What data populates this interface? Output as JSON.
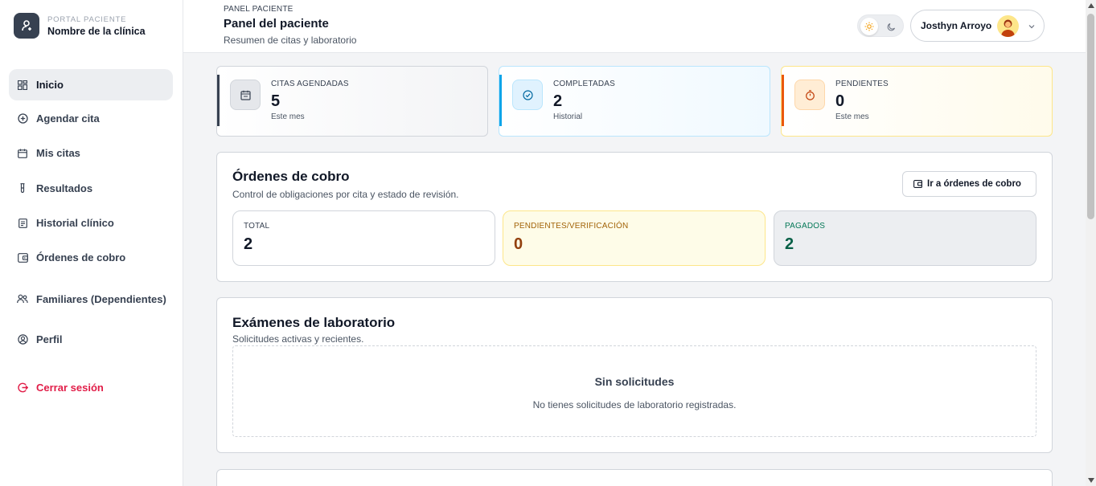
{
  "brand": {
    "kicker": "PORTAL PACIENTE",
    "name": "Nombre de la clínica"
  },
  "sidebar": {
    "items": [
      {
        "label": "Inicio",
        "icon": "dashboard-icon"
      },
      {
        "label": "Agendar cita",
        "icon": "plus-circle-icon"
      },
      {
        "label": "Mis citas",
        "icon": "calendar-icon"
      },
      {
        "label": "Resultados",
        "icon": "test-tube-icon"
      },
      {
        "label": "Historial clínico",
        "icon": "document-icon"
      },
      {
        "label": "Órdenes de cobro",
        "icon": "wallet-icon"
      },
      {
        "label": "Familiares (Dependientes)",
        "icon": "users-icon"
      },
      {
        "label": "Perfil",
        "icon": "user-circle-icon"
      }
    ],
    "logout": "Cerrar sesión",
    "active": "Inicio"
  },
  "header": {
    "breadcrumb": "PANEL PACIENTE",
    "title": "Panel del paciente",
    "subtitle": "Resumen de citas y laboratorio",
    "user": "Josthyn Arroyo"
  },
  "stats": [
    {
      "label": "CITAS AGENDADAS",
      "value": "5",
      "note": "Este mes",
      "accent": "#374151"
    },
    {
      "label": "COMPLETADAS",
      "value": "2",
      "note": "Historial",
      "accent": "#0ea5e9"
    },
    {
      "label": "PENDIENTES",
      "value": "0",
      "note": "Este mes",
      "accent": "#ea580c"
    }
  ],
  "orders": {
    "title": "Órdenes de cobro",
    "subtitle": "Control de obligaciones por cita y estado de revisión.",
    "button": "Ir a órdenes de cobro",
    "cards": [
      {
        "label": "TOTAL",
        "value": "2"
      },
      {
        "label": "PENDIENTES/VERIFICACIÓN",
        "value": "0"
      },
      {
        "label": "PAGADOS",
        "value": "2"
      }
    ]
  },
  "lab": {
    "title": "Exámenes de laboratorio",
    "subtitle": "Solicitudes activas y recientes.",
    "empty_title": "Sin solicitudes",
    "empty_sub": "No tienes solicitudes de laboratorio registradas."
  }
}
